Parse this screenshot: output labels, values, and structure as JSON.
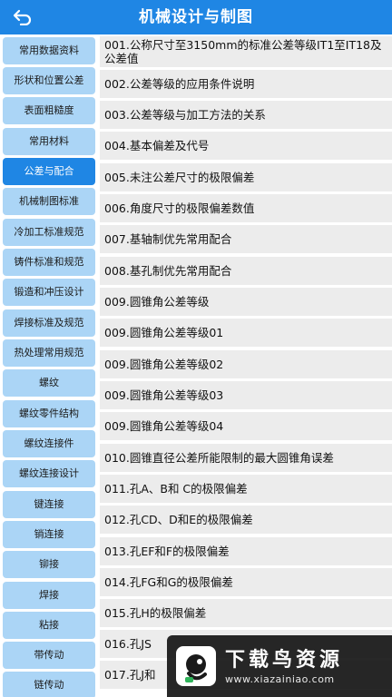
{
  "header": {
    "title": "机械设计与制图",
    "back_icon": "back-arrow-icon"
  },
  "colors": {
    "header_bg": "#1f86e4",
    "sidebar_item_bg": "#abd5f6",
    "sidebar_active_bg": "#1f86e4",
    "row_bg": "#ececec"
  },
  "sidebar": {
    "active_index": 4,
    "items": [
      {
        "label": "常用数据资料"
      },
      {
        "label": "形状和位置公差"
      },
      {
        "label": "表面粗糙度"
      },
      {
        "label": "常用材料"
      },
      {
        "label": "公差与配合"
      },
      {
        "label": "机械制图标准"
      },
      {
        "label": "冷加工标准规范"
      },
      {
        "label": "铸件标准和规范"
      },
      {
        "label": "锻造和冲压设计"
      },
      {
        "label": "焊接标准及规范"
      },
      {
        "label": "热处理常用规范"
      },
      {
        "label": "螺纹"
      },
      {
        "label": "螺纹零件结构"
      },
      {
        "label": "螺纹连接件"
      },
      {
        "label": "螺纹连接设计"
      },
      {
        "label": "键连接"
      },
      {
        "label": "销连接"
      },
      {
        "label": "铆接"
      },
      {
        "label": "焊接"
      },
      {
        "label": "粘接"
      },
      {
        "label": "带传动"
      },
      {
        "label": "链传动"
      }
    ]
  },
  "content": {
    "rows": [
      {
        "label": "001.公称尺寸至3150mm的标准公差等级IT1至IT18及公差值"
      },
      {
        "label": "002.公差等级的应用条件说明"
      },
      {
        "label": "003.公差等级与加工方法的关系"
      },
      {
        "label": "004.基本偏差及代号"
      },
      {
        "label": "005.未注公差尺寸的极限偏差"
      },
      {
        "label": "006.角度尺寸的极限偏差数值"
      },
      {
        "label": "007.基轴制优先常用配合"
      },
      {
        "label": "008.基孔制优先常用配合"
      },
      {
        "label": "009.圆锥角公差等级"
      },
      {
        "label": "009.圆锥角公差等级01"
      },
      {
        "label": "009.圆锥角公差等级02"
      },
      {
        "label": "009.圆锥角公差等级03"
      },
      {
        "label": "009.圆锥角公差等级04"
      },
      {
        "label": "010.圆锥直径公差所能限制的最大圆锥角误差"
      },
      {
        "label": "011.孔A、B和 C的极限偏差"
      },
      {
        "label": "012.孔CD、D和E的极限偏差"
      },
      {
        "label": "013.孔EF和F的极限偏差"
      },
      {
        "label": "014.孔FG和G的极限偏差"
      },
      {
        "label": "015.孔H的极限偏差"
      },
      {
        "label": "016.孔JS"
      },
      {
        "label": "017.孔J和"
      }
    ]
  },
  "watermark": {
    "title": "下载鸟资源",
    "url": "www.xiazainiao.com",
    "logo_icon": "bird-logo-icon"
  }
}
